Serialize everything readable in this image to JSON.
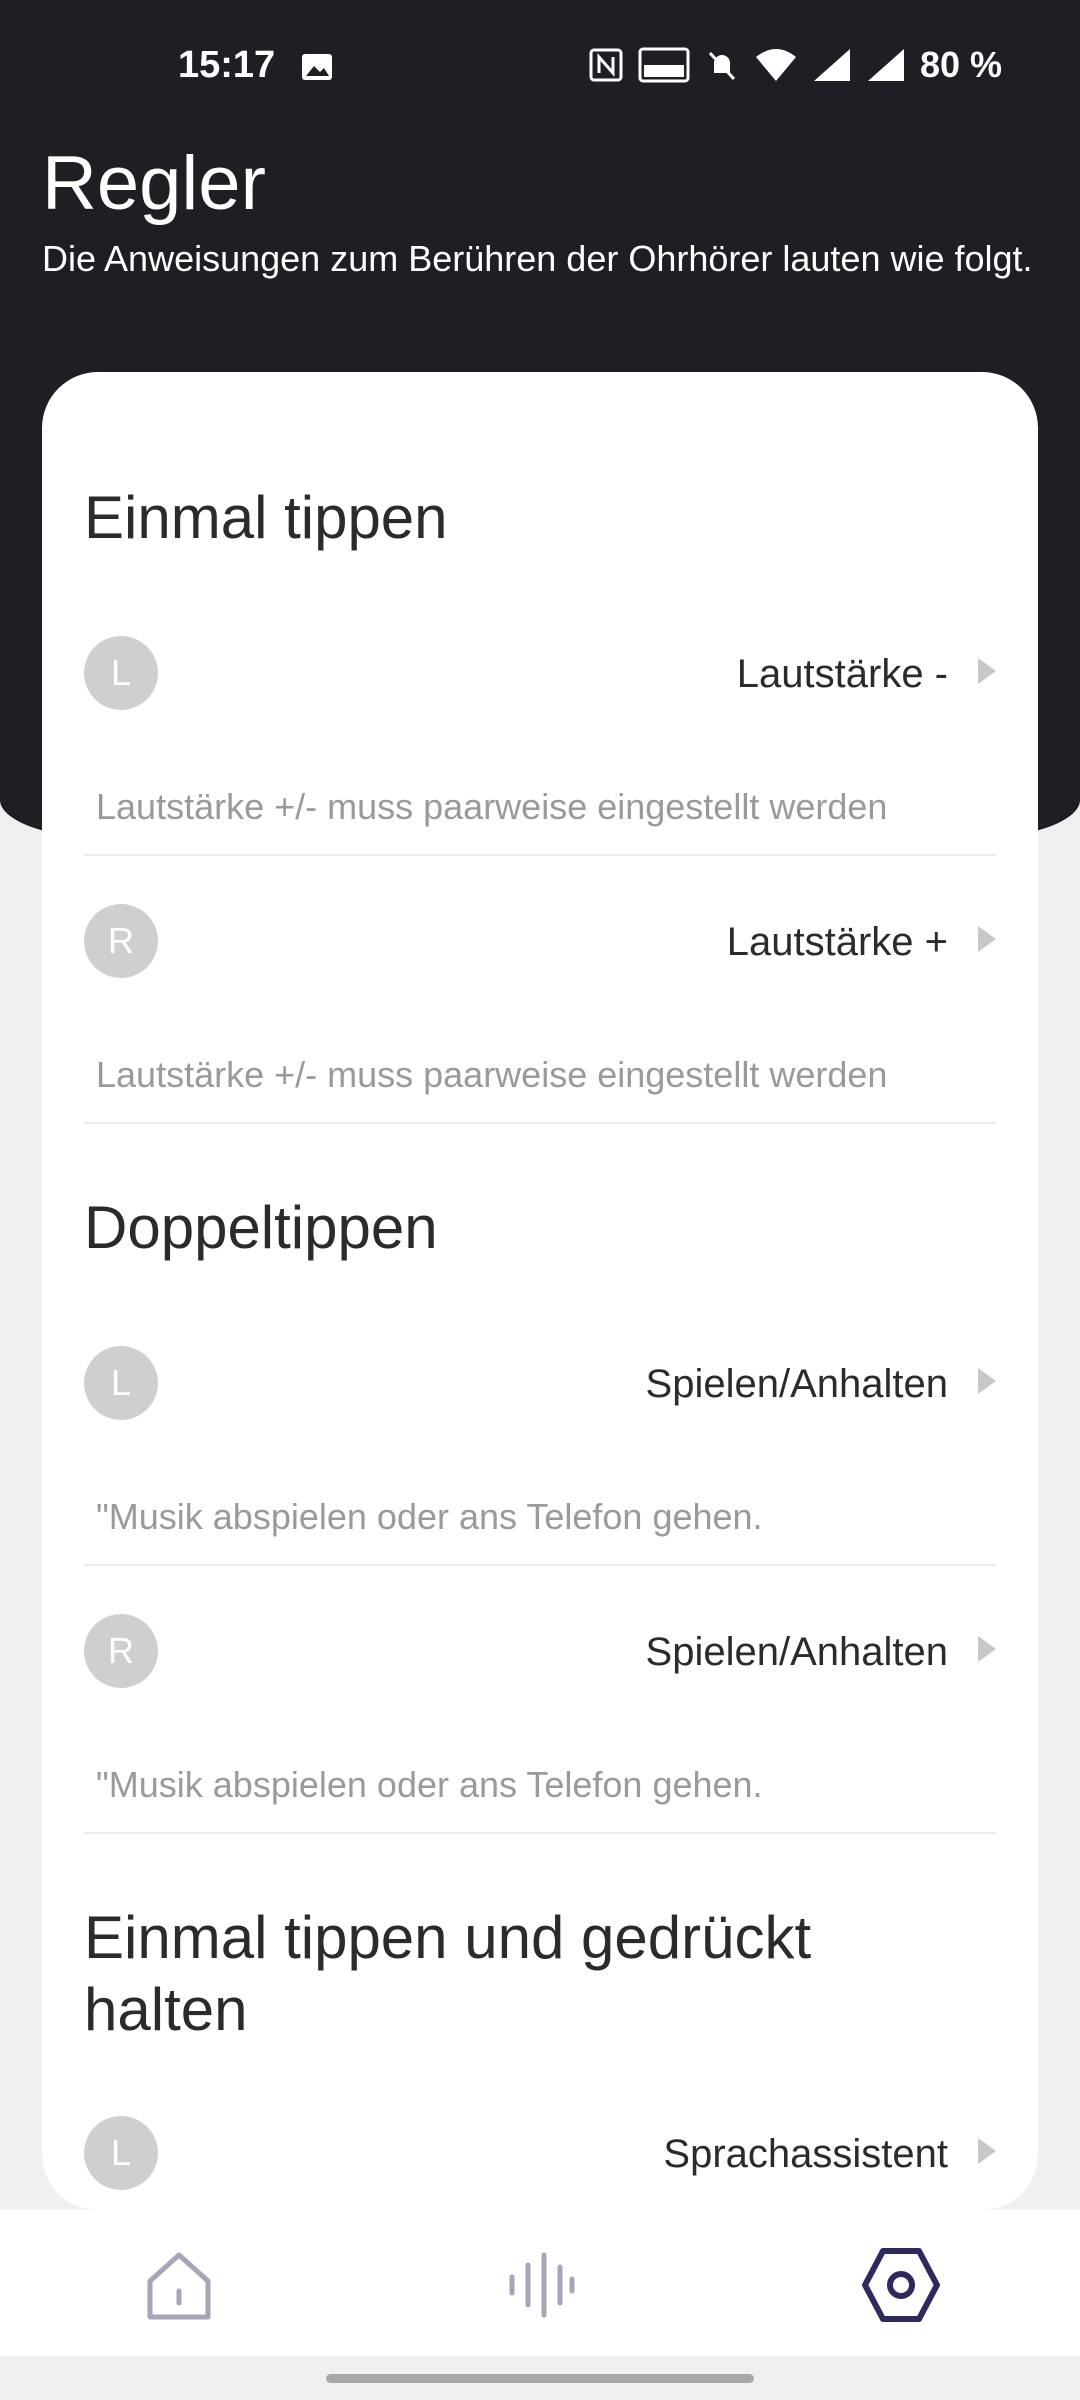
{
  "status_bar": {
    "time": "15:17",
    "battery_percent": "80 %",
    "icons": [
      "image-icon",
      "nfc-icon",
      "volte-icon",
      "mute-bell-icon",
      "wifi-icon",
      "signal-icon",
      "signal-icon"
    ]
  },
  "header": {
    "title": "Regler",
    "subtitle": "Die Anweisungen zum Berühren der Ohrhörer lauten wie folgt."
  },
  "sections": [
    {
      "title": "Einmal tippen",
      "rows": [
        {
          "side": "L",
          "action": "Lautstärke -",
          "note": "Lautstärke +/- muss paarweise eingestellt werden"
        },
        {
          "side": "R",
          "action": "Lautstärke +",
          "note": "Lautstärke +/- muss paarweise eingestellt werden"
        }
      ]
    },
    {
      "title": "Doppeltippen",
      "rows": [
        {
          "side": "L",
          "action": "Spielen/Anhalten",
          "note": "\"Musik abspielen oder ans Telefon gehen."
        },
        {
          "side": "R",
          "action": "Spielen/Anhalten",
          "note": "\"Musik abspielen oder ans Telefon gehen."
        }
      ]
    },
    {
      "title": "Einmal tippen und gedrückt halten",
      "rows": [
        {
          "side": "L",
          "action": "Sprachassistent"
        }
      ]
    }
  ],
  "bottom_nav": {
    "items": [
      "home-icon",
      "sound-wave-icon",
      "settings-hexagon-icon"
    ],
    "active": "settings-hexagon-icon",
    "active_color": "#2e2a5e",
    "inactive_color": "#a7a5b8"
  }
}
